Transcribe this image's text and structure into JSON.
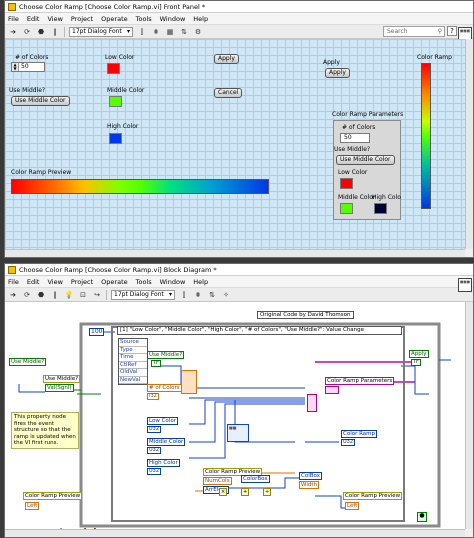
{
  "front_panel": {
    "title": "Choose Color Ramp [Choose Color Ramp.vi] Front Panel *",
    "menu": [
      "File",
      "Edit",
      "View",
      "Project",
      "Operate",
      "Tools",
      "Window",
      "Help"
    ],
    "font": "17pt Dialog Font",
    "search_placeholder": "Search",
    "num_colors_label": "# of Colors",
    "num_colors_value": "50",
    "use_middle_label": "Use Middle?",
    "use_middle_button": "Use Middle Color",
    "low_color_label": "Low Color",
    "middle_color_label": "Middle Color",
    "high_color_label": "High Color",
    "apply_button_1": "Apply",
    "cancel_button": "Cancel",
    "apply_label": "Apply",
    "apply_button_2": "Apply",
    "ramp_preview_label": "Color Ramp Preview",
    "color_ramp_label": "Color Ramp",
    "params_label": "Color Ramp Parameters",
    "params_num_label": "# of Colors",
    "params_num_value": "50",
    "params_use_middle_label": "Use Middle?",
    "params_use_middle_button": "Use Middle Color",
    "params_low_label": "Low Color",
    "params_middle_label": "Middle Color",
    "params_high_label": "High Colo",
    "colors": {
      "low": "#ff0000",
      "middle": "#55ff00",
      "high": "#0037e6",
      "param_high": "#000033"
    }
  },
  "block_diagram": {
    "title": "Choose Color Ramp [Choose Color Ramp.vi] Block Diagram *",
    "menu": [
      "File",
      "Edit",
      "View",
      "Project",
      "Operate",
      "Tools",
      "Window",
      "Help"
    ],
    "font": "17pt Dialog Font",
    "credit": "Original Code  by David Thomson",
    "event_case": "[1] \"Low Color\", \"Middle Color\", \"High Color\", \"# of Colors\", \"Use Middle?\": Value Change",
    "timeout_const": "100",
    "event_data": [
      "Source",
      "Type",
      "Time",
      "CtlRef",
      "OldVal",
      "NewVal"
    ],
    "nodes": {
      "use_middle_outer": "Use Middle?",
      "use_middle_prop": "Use Middle?",
      "val_sgnl": "Val(Sgnl)",
      "use_middle_inner": "Use Middle?",
      "num_colors": "# of Colors",
      "low_color": "Low Color",
      "middle_color": "Middle Color",
      "high_color": "High Color",
      "ramp_preview_inner": "Color Ramp Preview",
      "num_cols": "NumCols",
      "color_box": "ColorBox",
      "arr_elem": "ArrElem",
      "color_ramp_params": "Color Ramp Parameters",
      "color_ramp": "Color Ramp",
      "apply": "Apply",
      "color_ramp_preview_outer": "Color Ramp Preview",
      "left_outer": "Left",
      "color_ramp_preview_right": "Color Ramp Preview",
      "left_right": "Left",
      "col_box": "ColBox",
      "width": "Width",
      "tf": "TF",
      "i32": "I32",
      "u32": "U32",
      "dbl": "DBL"
    },
    "note": "This property node fires the event structure so that the ramp is updated when the VI first runs."
  }
}
